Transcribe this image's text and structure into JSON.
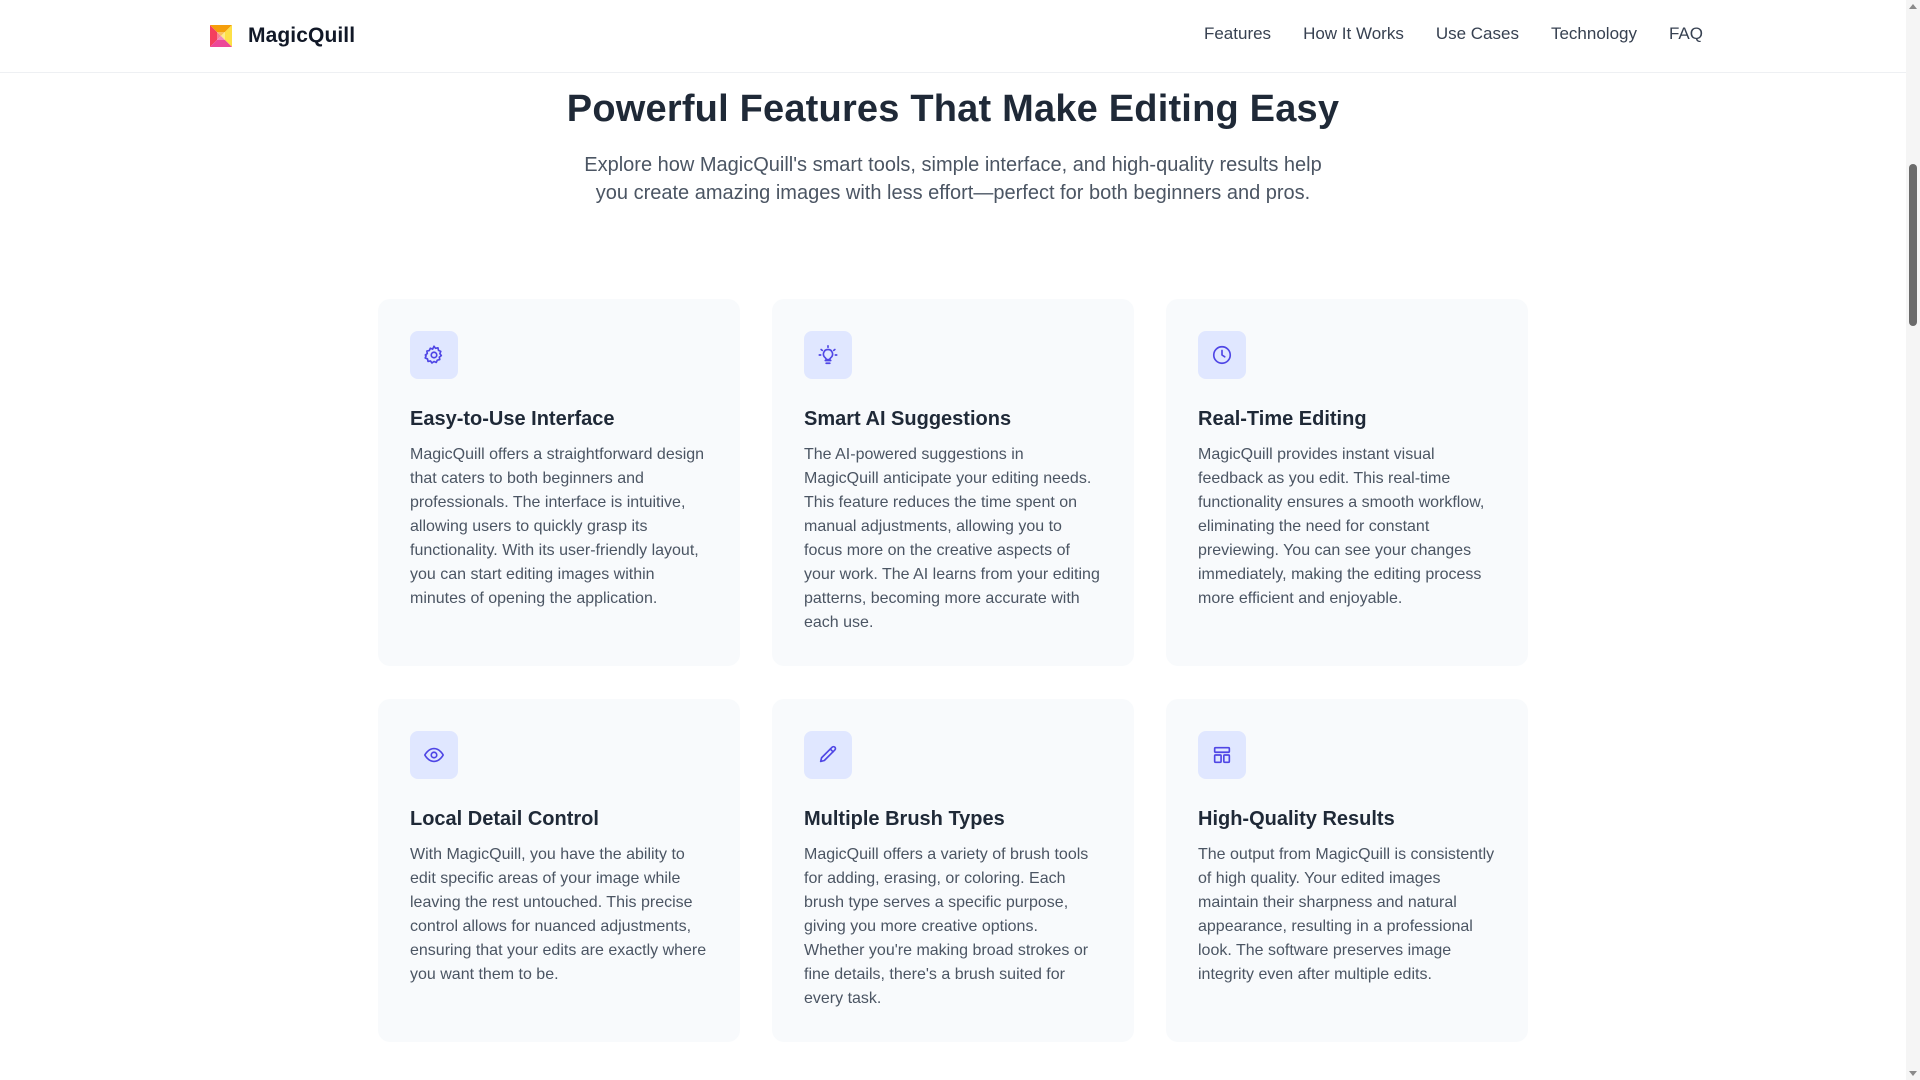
{
  "header": {
    "brand_name": "MagicQuill",
    "nav": [
      {
        "label": "Features"
      },
      {
        "label": "How It Works"
      },
      {
        "label": "Use Cases"
      },
      {
        "label": "Technology"
      },
      {
        "label": "FAQ"
      }
    ]
  },
  "section": {
    "title": "Powerful Features That Make Editing Easy",
    "subtitle": "Explore how MagicQuill's smart tools, simple interface, and high-quality results help you create amazing images with less effort—perfect for both beginners and pros."
  },
  "features": [
    {
      "icon": "gear-icon",
      "title": "Easy-to-Use Interface",
      "body": "MagicQuill offers a straightforward design that caters to both beginners and professionals. The interface is intuitive, allowing users to quickly grasp its functionality. With its user-friendly layout, you can start editing images within minutes of opening the application."
    },
    {
      "icon": "lightbulb-icon",
      "title": "Smart AI Suggestions",
      "body": "The AI-powered suggestions in MagicQuill anticipate your editing needs. This feature reduces the time spent on manual adjustments, allowing you to focus more on the creative aspects of your work. The AI learns from your editing patterns, becoming more accurate with each use."
    },
    {
      "icon": "clock-icon",
      "title": "Real-Time Editing",
      "body": "MagicQuill provides instant visual feedback as you edit. This real-time functionality ensures a smooth workflow, eliminating the need for constant previewing. You can see your changes immediately, making the editing process more efficient and enjoyable."
    },
    {
      "icon": "eye-icon",
      "title": "Local Detail Control",
      "body": "With MagicQuill, you have the ability to edit specific areas of your image while leaving the rest untouched. This precise control allows for nuanced adjustments, ensuring that your edits are exactly where you want them to be."
    },
    {
      "icon": "pencil-icon",
      "title": "Multiple Brush Types",
      "body": "MagicQuill offers a variety of brush tools for adding, erasing, or coloring. Each brush type serves a specific purpose, giving you more creative options. Whether you're making broad strokes or fine details, there's a brush suited for every task."
    },
    {
      "icon": "layout-icon",
      "title": "High-Quality Results",
      "body": "The output from MagicQuill is consistently of high quality. Your edited images maintain their sharpness and natural appearance, resulting in a professional look. The software preserves image integrity even after multiple edits."
    }
  ],
  "colors": {
    "accent": "#4f46e5",
    "icon_bg": "#e0e7ff",
    "card_bg": "#f8fafc",
    "heading": "#1f2937",
    "body_text": "#4b5563"
  }
}
